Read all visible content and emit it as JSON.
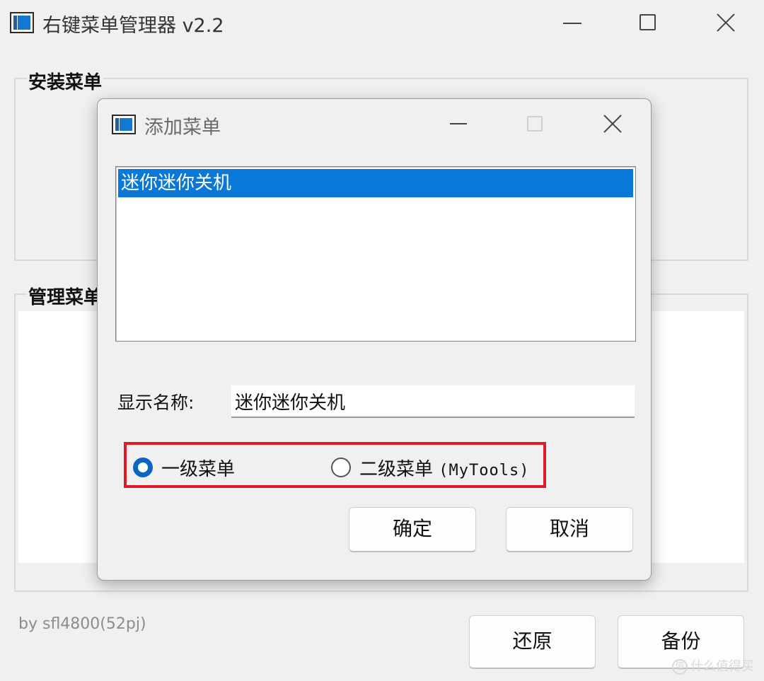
{
  "window": {
    "title": "右键菜单管理器 v2.2",
    "icon": "app-window-icon",
    "controls": [
      "minimize-icon",
      "maximize-icon",
      "close-icon"
    ]
  },
  "groups": {
    "install_label": "安装菜单",
    "manage_label": "管理菜单"
  },
  "footer": {
    "author": "by sfl4800(52pj)",
    "restore_label": "还原",
    "backup_label": "备份"
  },
  "dialog": {
    "title": "添加菜单",
    "list_items": [
      "迷你迷你关机"
    ],
    "selected_index": 0,
    "name_label": "显示名称:",
    "name_value": "迷你迷你关机",
    "radio_primary": "一级菜单",
    "radio_secondary_prefix": "二级菜单",
    "radio_secondary_tool": "(MyTools)",
    "selected_radio": "radio_primary",
    "ok_label": "确定",
    "cancel_label": "取消"
  },
  "watermark": "什么值得买",
  "colors": {
    "selection": "#0a78d7",
    "highlight_border": "#e01b28",
    "radio_checked": "#0a66c2",
    "window_bg": "#f0f0f0"
  }
}
